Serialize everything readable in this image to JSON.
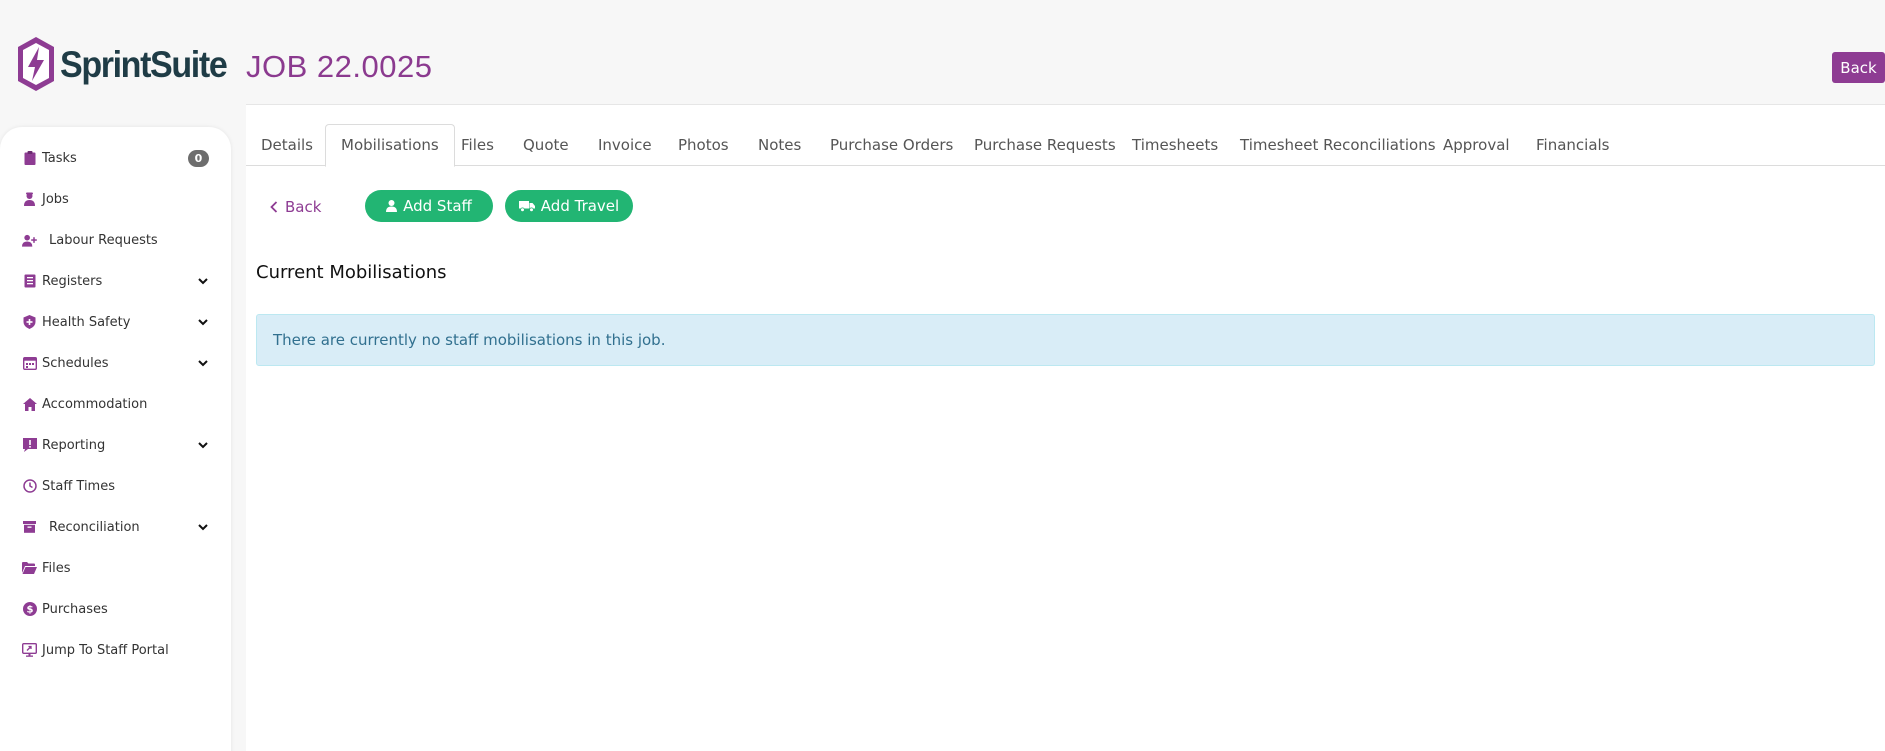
{
  "brand": {
    "name": "SprintSuite",
    "color": "#8e3c93",
    "text_color": "#1f3c46"
  },
  "header": {
    "title": "JOB 22.0025",
    "back_label": "Back"
  },
  "sidebar": {
    "items": [
      {
        "label": "Tasks",
        "icon": "clipboard-icon",
        "badge": "0"
      },
      {
        "label": "Jobs",
        "icon": "worker-icon"
      },
      {
        "label": "Labour Requests",
        "icon": "user-plus-icon"
      },
      {
        "label": "Registers",
        "icon": "book-icon",
        "expandable": true
      },
      {
        "label": "Health Safety",
        "icon": "shield-icon",
        "expandable": true
      },
      {
        "label": "Schedules",
        "icon": "calendar-icon",
        "expandable": true
      },
      {
        "label": "Accommodation",
        "icon": "home-icon"
      },
      {
        "label": "Reporting",
        "icon": "alert-report-icon",
        "expandable": true
      },
      {
        "label": "Staff Times",
        "icon": "clock-icon"
      },
      {
        "label": "Reconciliation",
        "icon": "archive-icon",
        "expandable": true
      },
      {
        "label": "Files",
        "icon": "folder-icon"
      },
      {
        "label": "Purchases",
        "icon": "dollar-icon"
      },
      {
        "label": "Jump To Staff Portal",
        "icon": "portal-icon"
      }
    ]
  },
  "tabs": [
    {
      "label": "Details"
    },
    {
      "label": "Mobilisations",
      "active": true
    },
    {
      "label": "Files"
    },
    {
      "label": "Quote"
    },
    {
      "label": "Invoice"
    },
    {
      "label": "Photos"
    },
    {
      "label": "Notes"
    },
    {
      "label": "Purchase Orders"
    },
    {
      "label": "Purchase Requests"
    },
    {
      "label": "Timesheets"
    },
    {
      "label": "Timesheet Reconciliations"
    },
    {
      "label": "Approval"
    },
    {
      "label": "Financials"
    }
  ],
  "toolbar": {
    "back_label": "Back",
    "add_staff_label": "Add Staff",
    "add_travel_label": "Add Travel"
  },
  "content": {
    "section_title": "Current Mobilisations",
    "empty_message": "There are currently no staff mobilisations in this job."
  },
  "colors": {
    "accent": "#8e3c93",
    "success": "#22b573",
    "info_bg": "#d9edf7",
    "info_text": "#31708f"
  }
}
